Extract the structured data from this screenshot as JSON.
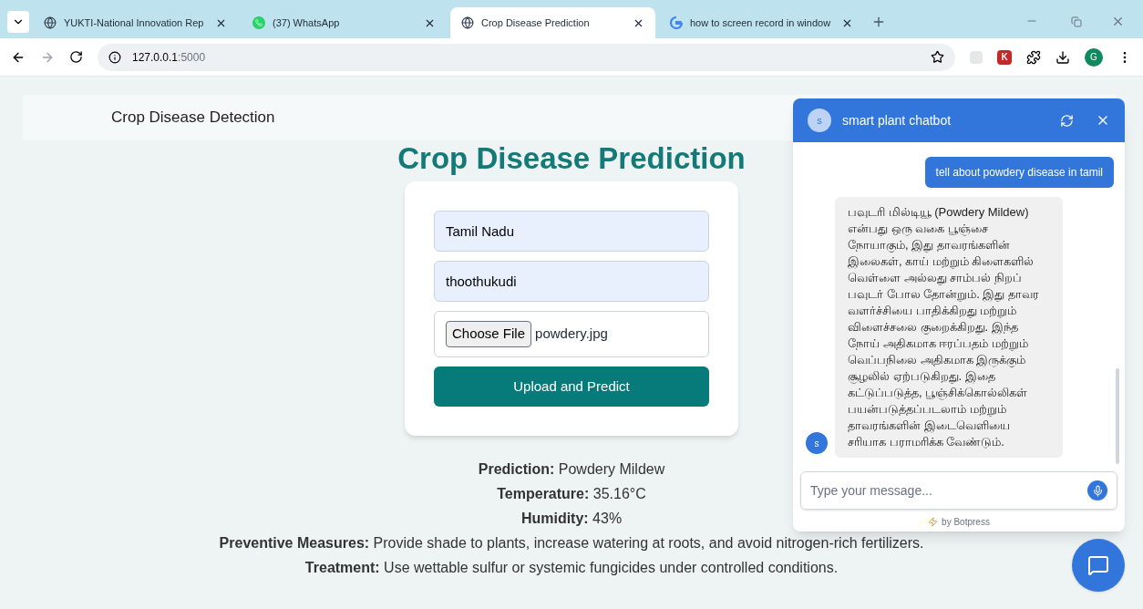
{
  "browser": {
    "tabs": [
      {
        "title": "YUKTI-National Innovation Rep",
        "kind": "globe",
        "selected": false
      },
      {
        "title": "(37) WhatsApp",
        "kind": "whatsapp",
        "selected": false
      },
      {
        "title": "Crop Disease Prediction",
        "kind": "globe",
        "selected": true
      },
      {
        "title": "how to screen record in window",
        "kind": "google",
        "selected": false
      }
    ],
    "address": {
      "host": "127.0.0.1",
      "port": ":5000"
    },
    "profile_initial": "G",
    "extension_letter": "K"
  },
  "navbar": {
    "brand": "Crop Disease Detection"
  },
  "form": {
    "title": "Crop Disease Prediction",
    "fields": [
      {
        "kind": "text",
        "value": "Tamil Nadu"
      },
      {
        "kind": "text",
        "value": "thoothukudi"
      },
      {
        "kind": "file",
        "button": "Choose File",
        "value": "powdery.jpg"
      }
    ],
    "submit": "Upload and Predict"
  },
  "results": [
    "**Prediction:** Powdery Mildew",
    "**Temperature:** 35.16°C",
    "**Humidity:** 43%",
    "**Preventive Measures:** Provide shade to plants, increase watering at roots, and avoid nitrogen-rich fertilizers.",
    "**Treatment:** Use wettable sulfur or systemic fungicides under controlled conditions."
  ],
  "chatbot": {
    "avatar": "s",
    "title": "smart plant chatbot",
    "messages": [
      {
        "kind": "user",
        "text": "tell about powdery disease in tamil"
      },
      {
        "kind": "bot",
        "avatar": "s",
        "text": "பவுடரி மில்டியூ (Powdery Mildew) என்பது ஒரு வகை பூஞ்சை நோயாகும், இது தாவரங்களின் இலைகள், காய் மற்றும் கிளைகளில் வெள்ளை அல்லது சாம்பல் நிறப் பவுடர் போல தோன்றும். இது தாவர வளர்ச்சியை பாதிக்கிறது மற்றும் விளைச்சலை குறைக்கிறது. இந்த நோய் அதிகமாக ஈரப்பதம் மற்றும் வெப்பநிலை அதிகமாக இருக்கும் சூழலில் ஏற்படுகிறது. இதை கட்டுப்படுத்த, பூஞ்சிக்கொல்லிகள் பயன்படுத்தப்படலாம் மற்றும் தாவரங்களின் இடைவெளியை சரியாக பராமரிக்க வேண்டும்."
      }
    ],
    "input_placeholder": "Type your message...",
    "footer": "by Botpress"
  }
}
